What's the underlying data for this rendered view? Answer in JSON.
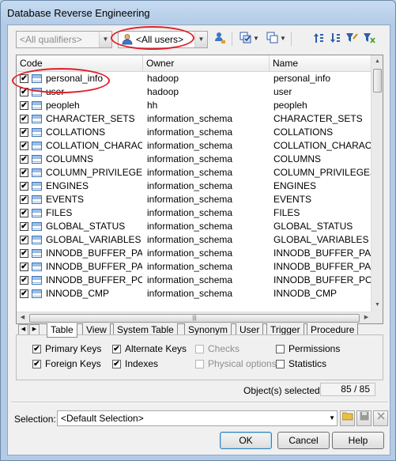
{
  "window": {
    "title": "Database Reverse Engineering"
  },
  "toolbar": {
    "qualifier_combo": "<All qualifiers>",
    "owner_combo": "<All users>",
    "icons": [
      "select-user-icon",
      "select-all-icon",
      "deselect-all-icon",
      "move-up-icon",
      "move-down-icon",
      "filter-icon",
      "clear-filter-icon"
    ]
  },
  "table": {
    "columns": [
      "Code",
      "Owner",
      "Name"
    ],
    "rows": [
      {
        "code": "personal_info",
        "owner": "hadoop",
        "name": "personal_info",
        "checked": true
      },
      {
        "code": "user",
        "owner": "hadoop",
        "name": "user",
        "checked": true
      },
      {
        "code": "peopleh",
        "owner": "hh",
        "name": "peopleh",
        "checked": true
      },
      {
        "code": "CHARACTER_SETS",
        "owner": "information_schema",
        "name": "CHARACTER_SETS",
        "checked": true
      },
      {
        "code": "COLLATIONS",
        "owner": "information_schema",
        "name": "COLLATIONS",
        "checked": true
      },
      {
        "code": "COLLATION_CHARAC...",
        "owner": "information_schema",
        "name": "COLLATION_CHARACTE",
        "checked": true
      },
      {
        "code": "COLUMNS",
        "owner": "information_schema",
        "name": "COLUMNS",
        "checked": true
      },
      {
        "code": "COLUMN_PRIVILEGES",
        "owner": "information_schema",
        "name": "COLUMN_PRIVILEGES",
        "checked": true
      },
      {
        "code": "ENGINES",
        "owner": "information_schema",
        "name": "ENGINES",
        "checked": true
      },
      {
        "code": "EVENTS",
        "owner": "information_schema",
        "name": "EVENTS",
        "checked": true
      },
      {
        "code": "FILES",
        "owner": "information_schema",
        "name": "FILES",
        "checked": true
      },
      {
        "code": "GLOBAL_STATUS",
        "owner": "information_schema",
        "name": "GLOBAL_STATUS",
        "checked": true
      },
      {
        "code": "GLOBAL_VARIABLES",
        "owner": "information_schema",
        "name": "GLOBAL_VARIABLES",
        "checked": true
      },
      {
        "code": "INNODB_BUFFER_PA...",
        "owner": "information_schema",
        "name": "INNODB_BUFFER_PAGE",
        "checked": true
      },
      {
        "code": "INNODB_BUFFER_PA...",
        "owner": "information_schema",
        "name": "INNODB_BUFFER_PAGE",
        "checked": true
      },
      {
        "code": "INNODB_BUFFER_PO...",
        "owner": "information_schema",
        "name": "INNODB_BUFFER_POOI",
        "checked": true
      },
      {
        "code": "INNODB_CMP",
        "owner": "information_schema",
        "name": "INNODB_CMP",
        "checked": true
      }
    ]
  },
  "tabs": [
    "Table",
    "View",
    "System Table",
    "Synonym",
    "User",
    "Trigger",
    "Procedure"
  ],
  "active_tab": "Table",
  "options": [
    {
      "label": "Primary Keys",
      "checked": true,
      "enabled": true
    },
    {
      "label": "Alternate Keys",
      "checked": true,
      "enabled": true
    },
    {
      "label": "Checks",
      "checked": false,
      "enabled": false
    },
    {
      "label": "Permissions",
      "checked": false,
      "enabled": true
    },
    {
      "label": "Foreign Keys",
      "checked": true,
      "enabled": true
    },
    {
      "label": "Indexes",
      "checked": true,
      "enabled": true
    },
    {
      "label": "Physical options",
      "checked": false,
      "enabled": false
    },
    {
      "label": "Statistics",
      "checked": false,
      "enabled": true
    }
  ],
  "selection_count": {
    "label": "Object(s) selected:",
    "value": "85 / 85"
  },
  "selection": {
    "label": "Selection:",
    "value": "<Default Selection>"
  },
  "buttons": {
    "ok": "OK",
    "cancel": "Cancel",
    "help": "Help"
  },
  "colors": {
    "annotation": "#e0202a",
    "title_bar": "#b9d1ea"
  }
}
